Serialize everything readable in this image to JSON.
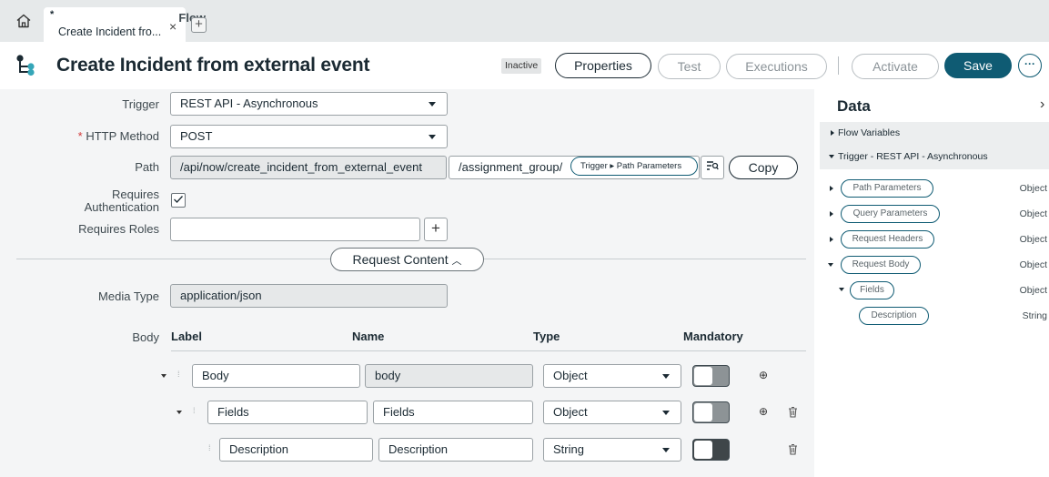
{
  "tabbar": {
    "tab": {
      "type": "Flow",
      "title": "Create Incident fro...",
      "modified_marker": "*"
    },
    "close_glyph": "×",
    "add_glyph": "+"
  },
  "header": {
    "title": "Create Incident from external event",
    "status": "Inactive",
    "properties": "Properties",
    "test": "Test",
    "executions": "Executions",
    "activate": "Activate",
    "save": "Save",
    "more_glyph": "···"
  },
  "form": {
    "trigger_label": "Trigger",
    "trigger_value": "REST API - Asynchronous",
    "http_method_label": "HTTP Method",
    "http_method_required": "*",
    "http_method_value": "POST",
    "path_label": "Path",
    "path_base": "/api/now/create_incident_from_external_event",
    "path_suffix": "/assignment_group/",
    "path_chip": "Trigger ▸ Path Parameters",
    "copy": "Copy",
    "requires_auth_label_1": "Requires",
    "requires_auth_label_2": "Authentication",
    "requires_auth_checked": true,
    "requires_roles_label": "Requires Roles",
    "requires_roles_value": "",
    "request_content": "Request Content",
    "media_type_label": "Media Type",
    "media_type_value": "application/json",
    "body_label": "Body"
  },
  "table": {
    "headers": {
      "label": "Label",
      "name": "Name",
      "type": "Type",
      "mandatory": "Mandatory"
    },
    "rows": [
      {
        "label": "Body",
        "name": "body",
        "type": "Object",
        "mandatory": false
      },
      {
        "label": "Fields",
        "name": "Fields",
        "type": "Object",
        "mandatory": false
      },
      {
        "label": "Description",
        "name": "Description",
        "type": "String",
        "mandatory": false
      }
    ]
  },
  "data_panel": {
    "title": "Data",
    "sections": [
      "Flow Variables",
      "Trigger - REST API - Asynchronous"
    ],
    "items": [
      {
        "label": "Path Parameters",
        "type": "Object"
      },
      {
        "label": "Query Parameters",
        "type": "Object"
      },
      {
        "label": "Request Headers",
        "type": "Object"
      },
      {
        "label": "Request Body",
        "type": "Object"
      },
      {
        "label": "Fields",
        "type": "Object"
      },
      {
        "label": "Description",
        "type": "String"
      }
    ]
  },
  "colors": {
    "accent": "#0f5b73",
    "required": "#d23b3b",
    "tabbar": "#e6e9ea",
    "panel": "#f4f5f6"
  }
}
